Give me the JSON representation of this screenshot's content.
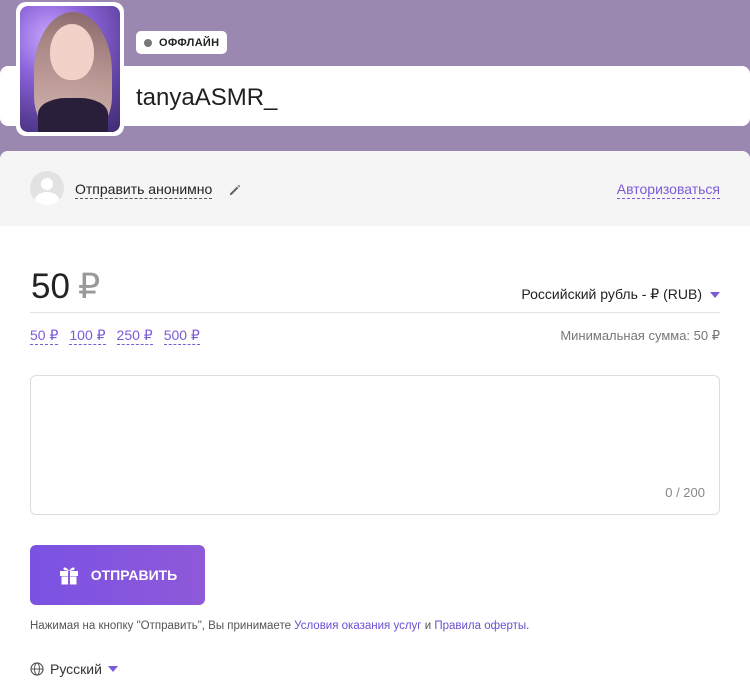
{
  "profile": {
    "status": "ОФФЛАЙН",
    "username": "tanyaASMR_"
  },
  "anon": {
    "label": "Отправить анонимно",
    "login": "Авторизоваться"
  },
  "amount": {
    "value": "50",
    "currency_symbol": "₽",
    "currency_select": "Российский рубль - ₽ (RUB)",
    "presets": [
      "50 ₽",
      "100 ₽",
      "250 ₽",
      "500 ₽"
    ],
    "min_sum": "Минимальная сумма: 50 ₽"
  },
  "message": {
    "counter": "0 / 200"
  },
  "send": {
    "label": "ОТПРАВИТЬ"
  },
  "terms": {
    "prefix": "Нажимая на кнопку \"Отправить\", Вы принимаете ",
    "link1": "Условия оказания услуг",
    "middle": " и ",
    "link2": "Правила оферты",
    "suffix": "."
  },
  "language": {
    "selected": "Русский"
  },
  "colors": {
    "accent": "#7b5cd6",
    "background": "#9b88b0"
  },
  "icons": [
    "pencil-icon",
    "gift-icon",
    "globe-icon",
    "caret-down-icon",
    "avatar-placeholder-icon"
  ]
}
